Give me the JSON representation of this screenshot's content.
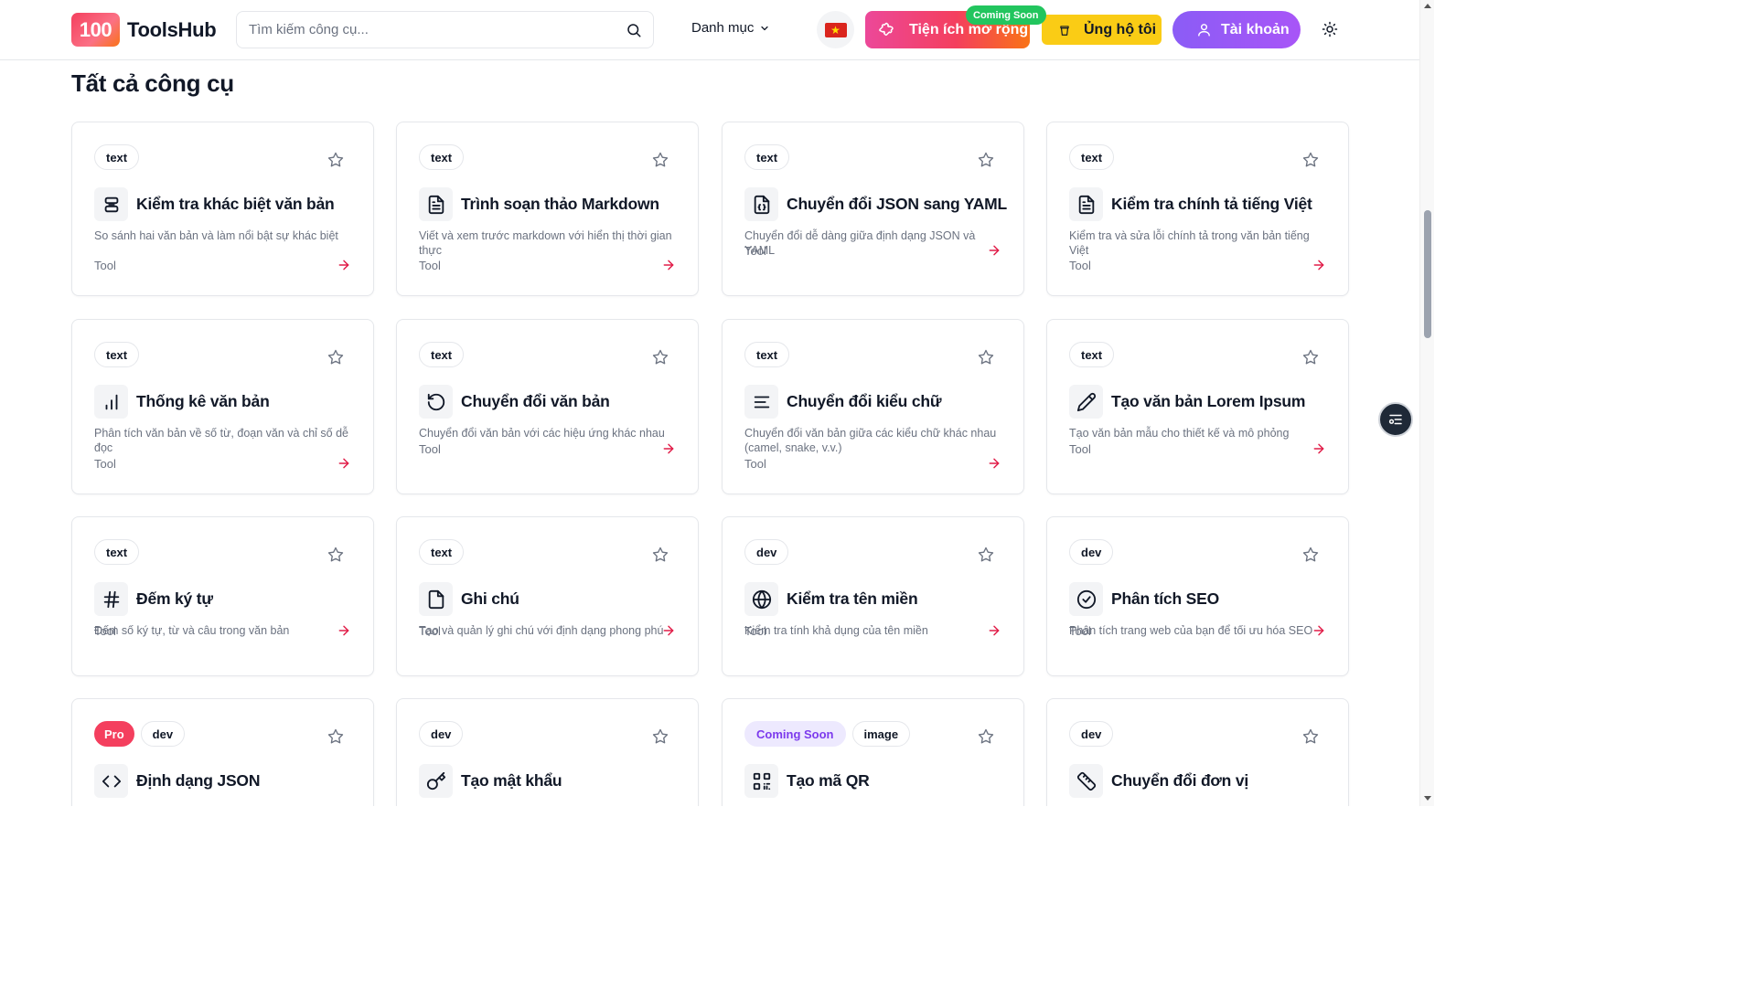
{
  "header": {
    "logo_badge": "100",
    "logo_text": "ToolsHub",
    "search_placeholder": "Tìm kiếm công cụ...",
    "category_label": "Danh mục",
    "extension_label": "Tiện ích mở rộng",
    "extension_badge": "Coming Soon",
    "support_label": "Ủng hộ tôi",
    "account_label": "Tài khoản",
    "accent_colors": {
      "pink": "#ec4899",
      "orange": "#f97316",
      "yellow": "#facc15",
      "purple": "#8b5cf6",
      "green": "#22c55e"
    }
  },
  "main": {
    "section_title": "Tất cả công cụ",
    "cards": [
      {
        "tags": [
          "text"
        ],
        "icon": "diff-icon",
        "title": "Kiểm tra khác biệt văn bản",
        "description": "So sánh hai văn bản và làm nổi bật sự khác biệt",
        "kind": "Tool"
      },
      {
        "tags": [
          "text"
        ],
        "icon": "file-text-icon",
        "title": "Trình soạn thảo Markdown",
        "description": "Viết và xem trước markdown với hiển thị thời gian thực",
        "kind": "Tool"
      },
      {
        "tags": [
          "text"
        ],
        "icon": "file-json-icon",
        "title": "Chuyển đổi JSON sang YAML",
        "description": "Chuyển đổi dễ dàng giữa định dạng JSON và YAML",
        "kind": "Tool"
      },
      {
        "tags": [
          "text"
        ],
        "icon": "file-check-icon",
        "title": "Kiểm tra chính tả tiếng Việt",
        "description": "Kiểm tra và sửa lỗi chính tả trong văn bản tiếng Việt",
        "kind": "Tool"
      },
      {
        "tags": [
          "text"
        ],
        "icon": "bar-chart-icon",
        "title": "Thống kê văn bản",
        "description": "Phân tích văn bản về số từ, đoạn văn và chỉ số dễ đọc",
        "kind": "Tool"
      },
      {
        "tags": [
          "text"
        ],
        "icon": "rotate-icon",
        "title": "Chuyển đổi văn bản",
        "description": "Chuyển đổi văn bản với các hiệu ứng khác nhau",
        "kind": "Tool"
      },
      {
        "tags": [
          "text"
        ],
        "icon": "align-left-icon",
        "title": "Chuyển đổi kiểu chữ",
        "description": "Chuyển đổi văn bản giữa các kiểu chữ khác nhau (camel, snake, v.v.)",
        "kind": "Tool"
      },
      {
        "tags": [
          "text"
        ],
        "icon": "pencil-icon",
        "title": "Tạo văn bản Lorem Ipsum",
        "description": "Tạo văn bản mẫu cho thiết kế và mô phỏng",
        "kind": "Tool"
      },
      {
        "tags": [
          "text"
        ],
        "icon": "hash-icon",
        "title": "Đếm ký tự",
        "description": "Đếm số ký tự, từ và câu trong văn bản",
        "kind": "Tool"
      },
      {
        "tags": [
          "text"
        ],
        "icon": "file-icon",
        "title": "Ghi chú",
        "description": "Tạo và quản lý ghi chú với định dạng phong phú",
        "kind": "Tool"
      },
      {
        "tags": [
          "dev"
        ],
        "icon": "globe-icon",
        "title": "Kiểm tra tên miền",
        "description": "Kiểm tra tính khả dụng của tên miền",
        "kind": "Tool"
      },
      {
        "tags": [
          "dev"
        ],
        "icon": "check-circle-icon",
        "title": "Phân tích SEO",
        "description": "Phân tích trang web của bạn để tối ưu hóa SEO",
        "kind": "Tool"
      },
      {
        "tags": [
          "Pro",
          "dev"
        ],
        "icon": "code-icon",
        "title": "Định dạng JSON",
        "description": "",
        "kind": "Tool"
      },
      {
        "tags": [
          "dev"
        ],
        "icon": "key-icon",
        "title": "Tạo mật khẩu",
        "description": "",
        "kind": "Tool"
      },
      {
        "tags": [
          "Coming Soon",
          "image"
        ],
        "icon": "qr-code-icon",
        "title": "Tạo mã QR",
        "description": "",
        "kind": "Tool"
      },
      {
        "tags": [
          "dev"
        ],
        "icon": "ruler-icon",
        "title": "Chuyển đổi đơn vị",
        "description": "",
        "kind": "Tool"
      }
    ]
  }
}
